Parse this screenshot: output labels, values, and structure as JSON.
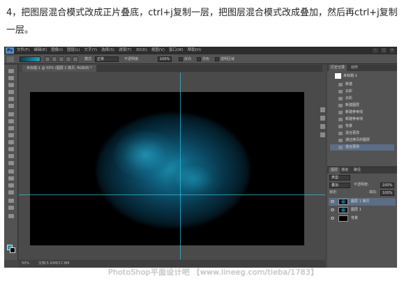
{
  "caption": "4，把图层混合模式改成正片叠底，ctrl+j复制一层，把图层混合模式改成叠加，然后再ctrl+j复制一层。",
  "app": {
    "logo": "Ps",
    "menus": [
      "文件(F)",
      "编辑(E)",
      "图像(I)",
      "图层(L)",
      "文字(Y)",
      "选择(S)",
      "滤镜(T)",
      "3D(D)",
      "视图(V)",
      "窗口(W)",
      "帮助(H)"
    ],
    "window_controls": [
      "–",
      "□",
      "×"
    ]
  },
  "options": {
    "mode_label": "模式:",
    "mode_value": "正常",
    "opacity_label": "不透明度:",
    "opacity_value": "100%",
    "reverse_label": "反向",
    "dither_label": "仿色",
    "transparency_label": "透明区域"
  },
  "document_tab": "未标题-1 @ 50% (图层 1 拷贝, RGB/8) *",
  "status": {
    "zoom": "50%",
    "doc": "文档:5.93M/17.8M"
  },
  "history": {
    "tabs": [
      "历史记录",
      "动作"
    ],
    "snapshot": "未标题-1",
    "items": [
      "新建",
      "云彩",
      "云彩",
      "新建图层",
      "新建参考线",
      "新建参考线",
      "背景",
      "混合更改",
      "通过拷贝的图层",
      "混合更改"
    ],
    "selected_index": 9
  },
  "layers": {
    "tabs": [
      "图层",
      "通道",
      "路径"
    ],
    "kind_label": "类型",
    "blend_mode": "叠加",
    "opacity_label": "不透明度:",
    "opacity_value": "100%",
    "lock_label": "锁定:",
    "fill_label": "填充:",
    "fill_value": "100%",
    "items": [
      {
        "name": "图层 1 拷贝",
        "selected": true
      },
      {
        "name": "图层 1",
        "selected": false
      },
      {
        "name": "背景",
        "selected": false
      }
    ]
  },
  "watermark": "PhotoShop平面设计吧 【www.lineeg.com/tieba/1783】",
  "colors": {
    "accent": "#1a9bb4",
    "guide": "#2ec4e8",
    "ps_dark": "#2d2d2d",
    "ps_panel": "#535353",
    "selection": "#5c6d85"
  }
}
